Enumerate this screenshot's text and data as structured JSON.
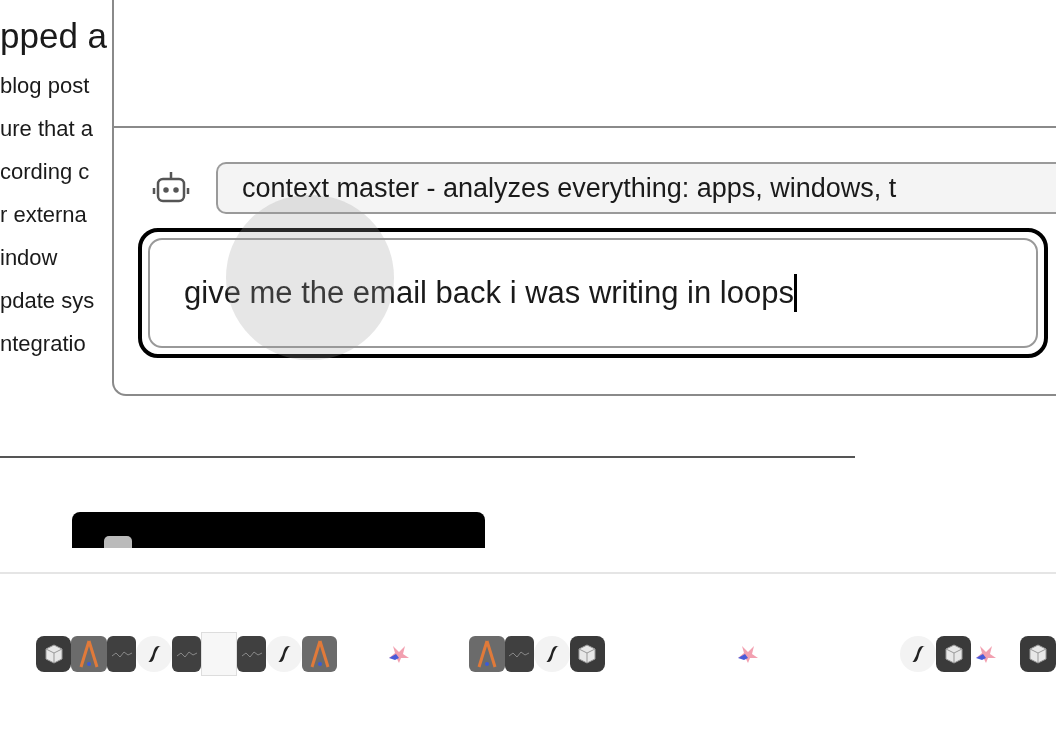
{
  "document": {
    "heading": "pped a",
    "lines": [
      "blog post",
      "ure that a",
      "cording c",
      "r externa",
      "indow",
      "pdate sys",
      "ntegratio"
    ]
  },
  "assistant": {
    "mode": "context master - analyzes everything: apps, windows, t",
    "input": {
      "value": "give me the email back i was writing in loops",
      "focused": true
    }
  }
}
